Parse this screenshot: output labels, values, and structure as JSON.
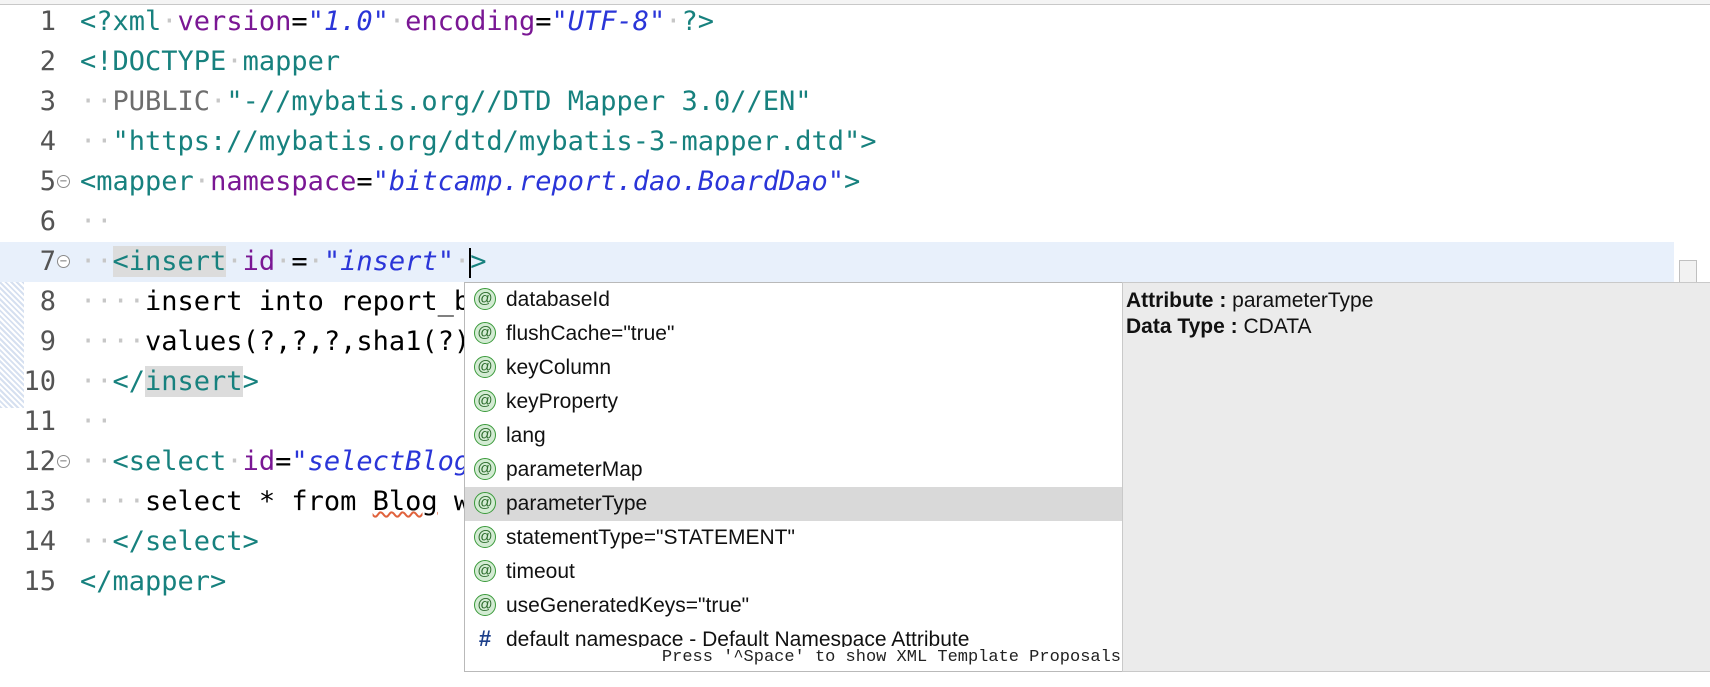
{
  "editor": {
    "lines": [
      {
        "num": "1",
        "fold": false
      },
      {
        "num": "2",
        "fold": false
      },
      {
        "num": "3",
        "fold": false
      },
      {
        "num": "4",
        "fold": false
      },
      {
        "num": "5",
        "fold": true
      },
      {
        "num": "6",
        "fold": false
      },
      {
        "num": "7",
        "fold": true
      },
      {
        "num": "8",
        "fold": false
      },
      {
        "num": "9",
        "fold": false
      },
      {
        "num": "10",
        "fold": false
      },
      {
        "num": "11",
        "fold": false
      },
      {
        "num": "12",
        "fold": true
      },
      {
        "num": "13",
        "fold": false
      },
      {
        "num": "14",
        "fold": false
      },
      {
        "num": "15",
        "fold": false
      }
    ],
    "code": {
      "l1": {
        "open": "<?xml",
        "attr1": "version",
        "eq1": "=",
        "val1": "\"1.0\"",
        "attr2": "encoding",
        "eq2": "=",
        "val2": "\"UTF-8\"",
        "close": "?>"
      },
      "l2": {
        "tag": "<!DOCTYPE",
        "name": "mapper"
      },
      "l3": {
        "kw": "PUBLIC",
        "str": "\"-//mybatis.org//DTD Mapper 3.0//EN\""
      },
      "l4": {
        "str": "\"https://mybatis.org/dtd/mybatis-3-mapper.dtd\"",
        "close": ">"
      },
      "l5": {
        "open": "<mapper",
        "attr": "namespace",
        "eq": "=",
        "val": "\"bitcamp.report.dao.BoardDao\"",
        "close": ">"
      },
      "l7": {
        "lt": "<",
        "tag": "insert",
        "attr": "id",
        "eq": "=",
        "val": "\"insert\"",
        "close": ">"
      },
      "l8": {
        "text": "insert into report_b"
      },
      "l9": {
        "text": "values(?,?,?,sha1(?)"
      },
      "l10": {
        "lt": "</",
        "tag": "insert",
        "close": ">"
      },
      "l12": {
        "open": "<select",
        "attr": "id",
        "eq": "=",
        "val": "\"selectBlog"
      },
      "l13": {
        "pre": "select * from ",
        "word": "Blog",
        "post": " w"
      },
      "l14": {
        "tag": "</select>"
      },
      "l15": {
        "tag": "</mapper>"
      }
    }
  },
  "autocomplete": {
    "items": [
      {
        "icon": "@",
        "label": "databaseId"
      },
      {
        "icon": "@",
        "label": "flushCache=\"true\""
      },
      {
        "icon": "@",
        "label": "keyColumn"
      },
      {
        "icon": "@",
        "label": "keyProperty"
      },
      {
        "icon": "@",
        "label": "lang"
      },
      {
        "icon": "@",
        "label": "parameterMap"
      },
      {
        "icon": "@",
        "label": "parameterType",
        "selected": true
      },
      {
        "icon": "@",
        "label": "statementType=\"STATEMENT\""
      },
      {
        "icon": "@",
        "label": "timeout"
      },
      {
        "icon": "@",
        "label": "useGeneratedKeys=\"true\""
      },
      {
        "icon": "#",
        "label": "default namespace - Default Namespace Attribute"
      }
    ],
    "hint": "Press '^Space' to show XML Template Proposals"
  },
  "info_panel": {
    "attribute_label": "Attribute :",
    "attribute_value": "parameterType",
    "datatype_label": "Data Type :",
    "datatype_value": "CDATA"
  },
  "colors": {
    "tag": "#17817e",
    "attribute": "#7a1794",
    "value": "#2a35d8",
    "current_line": "#e8f0fb",
    "selected_proposal": "#d9d9d9",
    "info_background": "#ebebeb"
  }
}
